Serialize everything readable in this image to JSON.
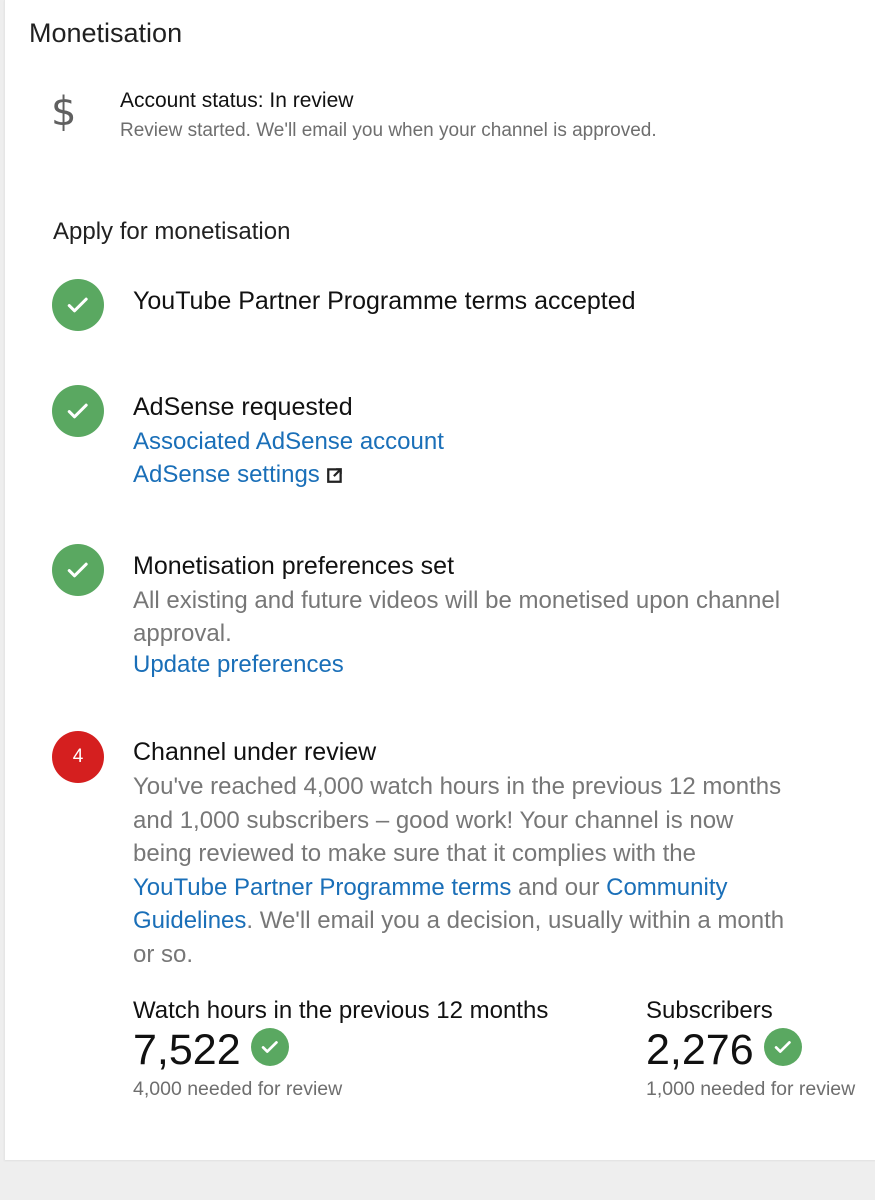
{
  "header": {
    "title": "Monetisation"
  },
  "account": {
    "icon": "dollar-icon",
    "dollar_symbol": "$",
    "status": "Account status: In review",
    "subtext": "Review started. We'll email you when your channel is approved."
  },
  "apply": {
    "heading": "Apply for monetisation",
    "steps": [
      {
        "state": "done",
        "title": "YouTube Partner Programme terms accepted"
      },
      {
        "state": "done",
        "title": "AdSense requested",
        "link1": "Associated AdSense account",
        "link2": "AdSense settings"
      },
      {
        "state": "done",
        "title": "Monetisation preferences set",
        "desc_line1": "All existing and future videos will be monetised upon channel",
        "desc_line2": "approval.",
        "link": "Update preferences"
      },
      {
        "state": "active",
        "number": "4",
        "title": "Channel under review",
        "para_1": "You've reached 4,000 watch hours in the previous 12 months and 1,000 subscribers – good work! Your channel is now being reviewed to make sure that it complies with the ",
        "link_terms": "YouTube Partner Programme terms",
        "para_2": " and our ",
        "link_guidelines": "Community Guidelines",
        "para_3": ". We'll email you a decision, usually within a month or so."
      }
    ]
  },
  "stats": {
    "watch_hours": {
      "label": "Watch hours in the previous 12 months",
      "value": "7,522",
      "needed": "4,000 needed for review"
    },
    "subscribers": {
      "label": "Subscribers",
      "value": "2,276",
      "needed": "1,000 needed for review"
    }
  },
  "colors": {
    "check_green": "#5aa861",
    "step_red": "#d51f1f",
    "link_blue": "#1a6fb8",
    "secondary_grey": "#777777"
  }
}
